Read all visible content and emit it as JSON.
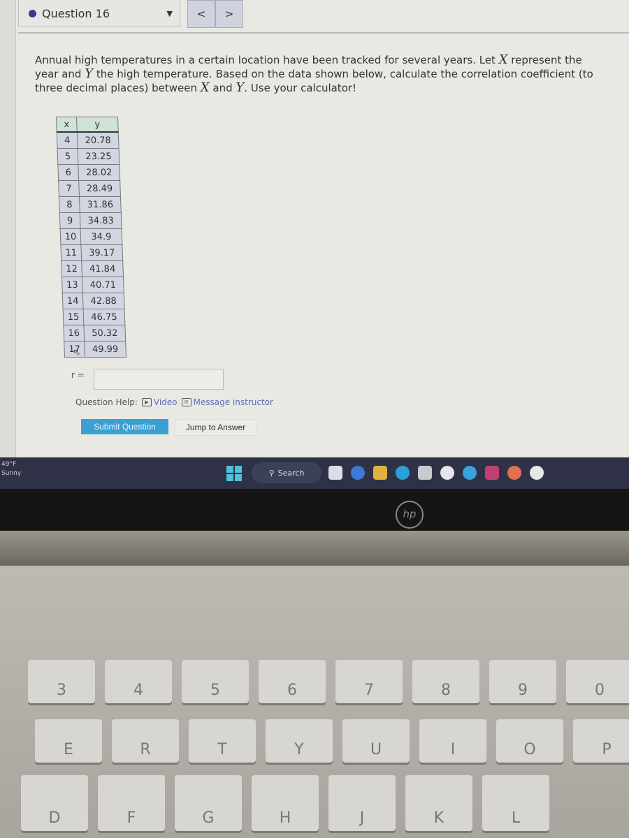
{
  "header": {
    "question_label": "Question 16",
    "prev_icon": "chevron-left",
    "next_icon": "chevron-right"
  },
  "question": {
    "part1": "Annual high temperatures in a certain location have been tracked for several years. Let ",
    "var_x": "X",
    "part2": " represent the year and ",
    "var_y": "Y",
    "part3": " the high temperature. Based on the data shown below, calculate the correlation coefficient (to three decimal places) between ",
    "part4": " and ",
    "part5": ". Use your calculator!"
  },
  "table": {
    "headers": [
      "x",
      "y"
    ],
    "rows": [
      [
        "4",
        "20.78"
      ],
      [
        "5",
        "23.25"
      ],
      [
        "6",
        "28.02"
      ],
      [
        "7",
        "28.49"
      ],
      [
        "8",
        "31.86"
      ],
      [
        "9",
        "34.83"
      ],
      [
        "10",
        "34.9"
      ],
      [
        "11",
        "39.17"
      ],
      [
        "12",
        "41.84"
      ],
      [
        "13",
        "40.71"
      ],
      [
        "14",
        "42.88"
      ],
      [
        "15",
        "46.75"
      ],
      [
        "16",
        "50.32"
      ],
      [
        "17",
        "49.99"
      ]
    ]
  },
  "answer": {
    "label": "r =",
    "value": ""
  },
  "help": {
    "label": "Question Help:",
    "video": "Video",
    "message": "Message instructor"
  },
  "buttons": {
    "submit": "Submit Question",
    "jump": "Jump to Answer"
  },
  "taskbar": {
    "temp": "49°F",
    "weather": "Sunny",
    "search": "Search"
  },
  "laptop": {
    "brand": "hp"
  },
  "keyboard": {
    "row1": [
      "3",
      "4",
      "5",
      "6",
      "7",
      "8",
      "9",
      "0"
    ],
    "row2": [
      "E",
      "R",
      "T",
      "Y",
      "U",
      "I",
      "O",
      "P"
    ],
    "row3": [
      "D",
      "F",
      "G",
      "H",
      "J",
      "K",
      "L"
    ]
  }
}
